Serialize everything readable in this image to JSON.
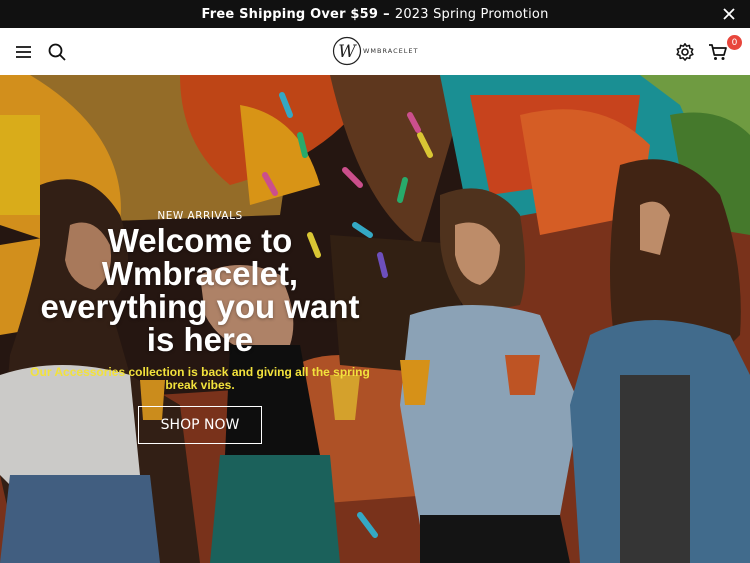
{
  "announcement": {
    "bold_text": "Free Shipping Over $59",
    "separator": "–",
    "promo_text": "2023 Spring Promotion"
  },
  "header": {
    "logo_text": "WMBRACELET",
    "logo_letter": "W",
    "cart_count": "0"
  },
  "hero": {
    "eyebrow": "NEW ARRIVALS",
    "headline_lines": [
      "Welcome to",
      "Wmbracelet,",
      "everything you want",
      "is here"
    ],
    "subline": "Our Accessories collection is back and giving all the spring break vibes.",
    "cta_label": "SHOP NOW"
  },
  "colors": {
    "announcement_bg": "#111111",
    "badge": "#e8463c",
    "subline": "#f2e23c"
  },
  "icons": [
    "close-icon",
    "menu-icon",
    "search-icon",
    "settings-icon",
    "cart-icon"
  ]
}
